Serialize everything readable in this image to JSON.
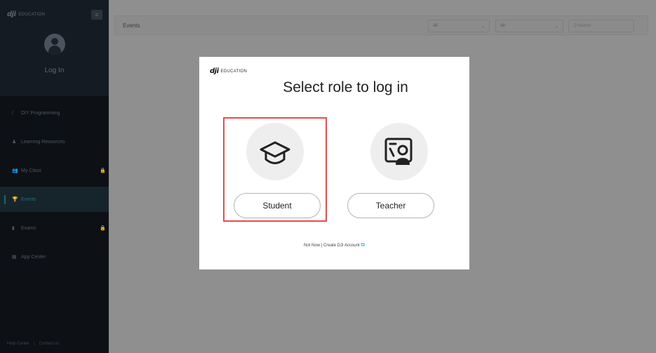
{
  "sidebar": {
    "logo_brand": "dji",
    "logo_text": "EDUCATION",
    "menu_icon": "≡",
    "login_label": "Log In",
    "items": [
      {
        "label": "DIY Programming",
        "icon": "/"
      },
      {
        "label": "Learning Resources",
        "icon": "♟"
      },
      {
        "label": "My Class",
        "icon": "👥"
      },
      {
        "label": "Events",
        "icon": "🏆"
      },
      {
        "label": "Exams",
        "icon": "▮"
      },
      {
        "label": "App Center",
        "icon": "▦"
      }
    ],
    "lock_icon": "🔒",
    "footer": {
      "help": "Help Center",
      "separator": "|",
      "contact": "Contact us"
    }
  },
  "topbar": {
    "title": "Events",
    "filter1": "All",
    "filter2": "All",
    "chevron": "⌄",
    "search_placeholder": "Q Search"
  },
  "modal": {
    "logo_brand": "dji",
    "logo_text": "EDUCATION",
    "title": "Select role to log in",
    "student_label": "Student",
    "teacher_label": "Teacher",
    "not_now": "Not Now",
    "separator": "|",
    "create_account": "Create DJI Account",
    "external_icon": "⧉"
  },
  "colors": {
    "sidebar_bg": "#0d1014",
    "overlay": "#8f8f8f",
    "active_accent": "#1a6670",
    "selected_border": "#e94b4b",
    "link_icon": "#2aa0d8"
  }
}
